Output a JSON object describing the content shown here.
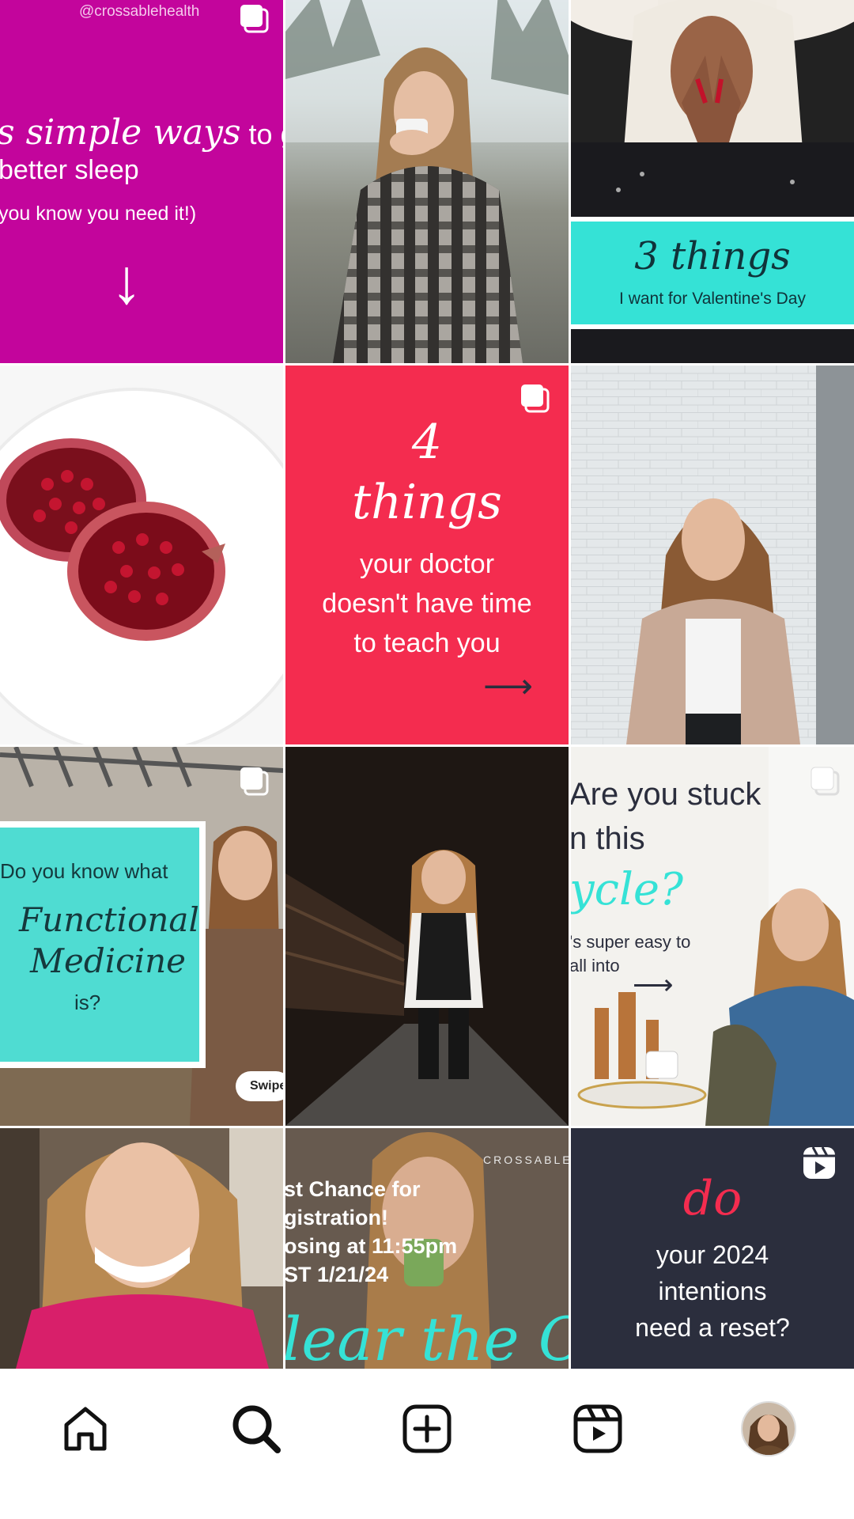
{
  "tiles": {
    "t1": {
      "watermark": "@crossablehealth",
      "line1a": "s simple ways",
      "line1b": " to get",
      "line2": "better sleep",
      "line3": "you know you need it!)",
      "arrow": "↓"
    },
    "t3": {
      "title": "3 things",
      "subtitle": "I want for Valentine's Day"
    },
    "t5": {
      "num": "4",
      "title": "things",
      "body1": "your doctor",
      "body2": "doesn't have time",
      "body3": "to teach you",
      "arrow": "⟶"
    },
    "t7": {
      "line1": "Do you know what",
      "line2": "Functional",
      "line3": "Medicine",
      "line4": "is?",
      "swipe": "Swipe"
    },
    "t9": {
      "line1": "Are you stuck",
      "line2": "n this",
      "line3": "ycle?",
      "line4": "'s super easy to",
      "line5": "all into",
      "arrow": "⟶"
    },
    "t11": {
      "brand": "CROSSABLE H",
      "line1": "st Chance for",
      "line2": "gistration!",
      "line3": "osing at 11:55pm",
      "line4": "ST 1/21/24",
      "script": "lear the Cr"
    },
    "t12": {
      "word": "do",
      "line1": "your 2024",
      "line2": "intentions",
      "line3": "need a reset?"
    }
  },
  "nav": {
    "items": [
      "home",
      "search",
      "create",
      "reels",
      "profile"
    ]
  },
  "colors": {
    "magenta": "#c3059c",
    "teal": "#35e2d6",
    "coral": "#f42c4f",
    "navy": "#2b2e3d"
  }
}
